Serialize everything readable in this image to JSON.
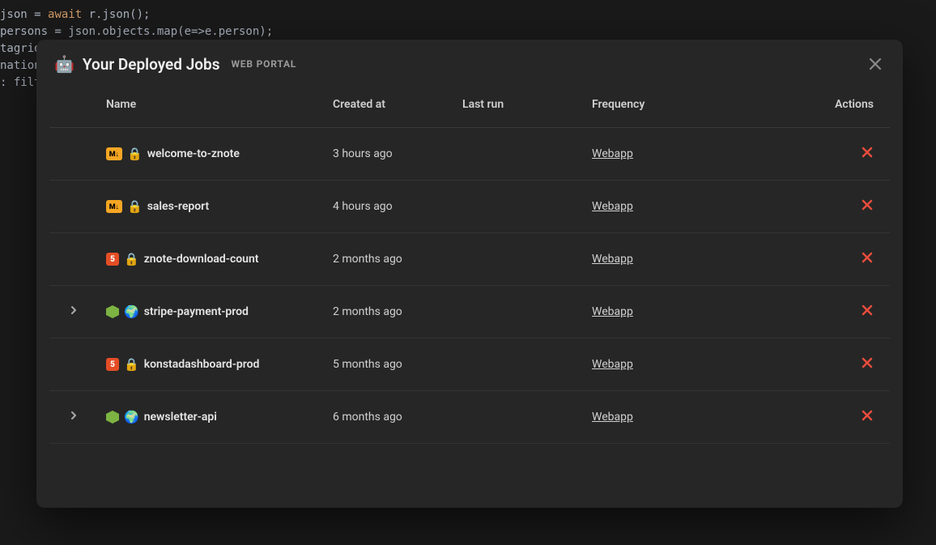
{
  "background_code": {
    "line1_pre": "json = ",
    "line1_await": "await",
    "line1_post": " r.json();",
    "line2": "persons = json.objects.map(e=>e.person);",
    "line3": "tagrid",
    "line4": "nation",
    "line5": ": filt"
  },
  "modal": {
    "icon": "🤖",
    "title": "Your Deployed Jobs",
    "subtitle": "WEB PORTAL"
  },
  "columns": {
    "expand": "",
    "name": "Name",
    "created": "Created at",
    "lastrun": "Last run",
    "frequency": "Frequency",
    "actions": "Actions"
  },
  "frequency_label": "Webapp",
  "rows": [
    {
      "expandable": false,
      "type": "md",
      "visibility": "lock",
      "name": "welcome-to-znote",
      "created": "3 hours ago",
      "lastrun": ""
    },
    {
      "expandable": false,
      "type": "md",
      "visibility": "lock",
      "name": "sales-report",
      "created": "4 hours ago",
      "lastrun": ""
    },
    {
      "expandable": false,
      "type": "js",
      "visibility": "lock",
      "name": "znote-download-count",
      "created": "2 months ago",
      "lastrun": ""
    },
    {
      "expandable": true,
      "type": "node",
      "visibility": "globe",
      "name": "stripe-payment-prod",
      "created": "2 months ago",
      "lastrun": ""
    },
    {
      "expandable": false,
      "type": "js",
      "visibility": "lock",
      "name": "konstadashboard-prod",
      "created": "5 months ago",
      "lastrun": ""
    },
    {
      "expandable": true,
      "type": "node",
      "visibility": "globe",
      "name": "newsletter-api",
      "created": "6 months ago",
      "lastrun": ""
    }
  ]
}
